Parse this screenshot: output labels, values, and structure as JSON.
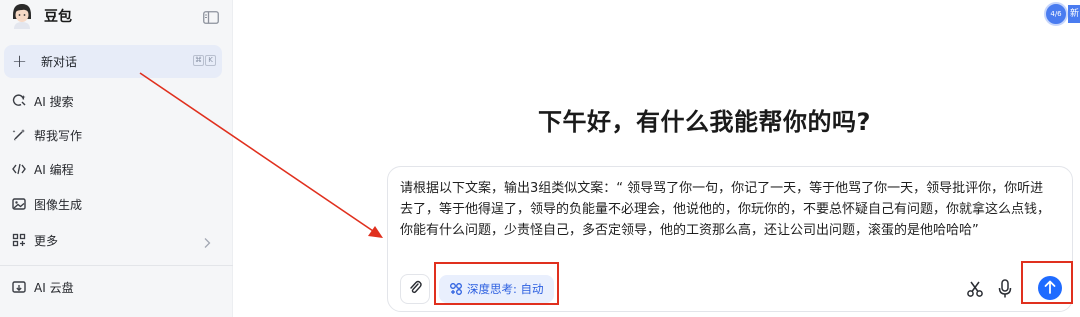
{
  "sidebar": {
    "brand": "豆包",
    "new_chat": {
      "label": "新对话",
      "shortcut": [
        "⌘",
        "K"
      ]
    },
    "items": [
      {
        "label": "AI 搜索",
        "icon": "search-spark-icon"
      },
      {
        "label": "帮我写作",
        "icon": "pen-icon"
      },
      {
        "label": "AI 编程",
        "icon": "code-icon"
      },
      {
        "label": "图像生成",
        "icon": "image-icon"
      },
      {
        "label": "更多",
        "icon": "grid-icon"
      },
      {
        "label": "AI 云盘",
        "icon": "cloud-drive-icon"
      }
    ]
  },
  "main": {
    "greeting": "下午好，有什么我能帮你的吗?",
    "prompt_text": "请根据以下文案，输出3组类似文案：“ 领导骂了你一句，你记了一天，等于他骂了你一天，领导批评你，你听进去了，等于他得逞了，领导的负能量不必理会，他说他的，你玩你的，不要总怀疑自己有问题，你就拿这么点钱，你能有什么问题，少责怪自己，多否定领导，他的工资那么高，还让公司出问题，滚蛋的是他哈哈哈”",
    "deep_think_label": "深度思考: 自动"
  },
  "badge": {
    "text": "4/6",
    "tail": "新"
  },
  "colors": {
    "accent": "#1f6bff",
    "annotation": "#e0301e",
    "sidebar_bg": "#f5f6f8"
  }
}
